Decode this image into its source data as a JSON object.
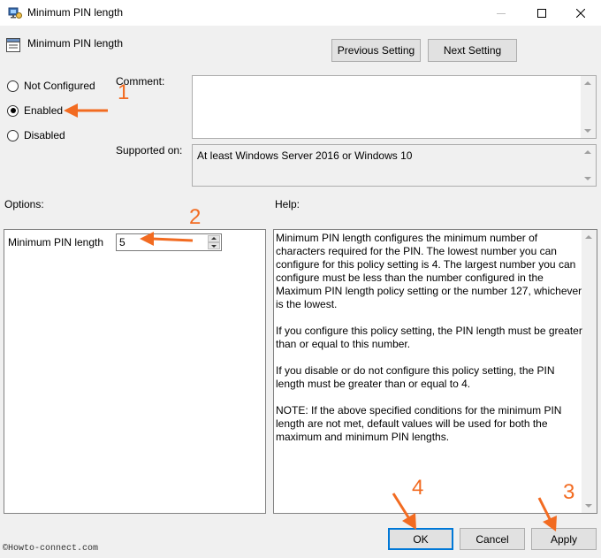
{
  "window": {
    "title": "Minimum PIN length"
  },
  "header": {
    "policy_title": "Minimum PIN length",
    "previous_label": "Previous Setting",
    "next_label": "Next Setting"
  },
  "state": {
    "options": [
      {
        "label": "Not Configured",
        "checked": false
      },
      {
        "label": "Enabled",
        "checked": true
      },
      {
        "label": "Disabled",
        "checked": false
      }
    ]
  },
  "comment": {
    "label": "Comment:",
    "value": ""
  },
  "supported": {
    "label": "Supported on:",
    "value": "At least Windows Server 2016 or Windows 10"
  },
  "options_panel": {
    "heading": "Options:",
    "field_label": "Minimum PIN length",
    "field_value": "5"
  },
  "help_panel": {
    "heading": "Help:",
    "paragraphs": [
      "Minimum PIN length configures the minimum number of characters required for the PIN.  The lowest number you can configure for this policy setting is 4.  The largest number you can configure must be less than the number configured in the Maximum PIN length policy setting or the number 127, whichever is the lowest.",
      "If you configure this policy setting, the PIN length must be greater than or equal to this number.",
      "If you disable or do not configure this policy setting, the PIN length must be greater than or equal to 4.",
      "NOTE: If the above specified conditions for the minimum PIN length are not met, default values will be used for both the maximum and minimum PIN lengths."
    ]
  },
  "footer": {
    "ok_label": "OK",
    "cancel_label": "Cancel",
    "apply_label": "Apply"
  },
  "annotations": {
    "n1": "1",
    "n2": "2",
    "n3": "3",
    "n4": "4",
    "color": "#f26b21"
  },
  "watermark": "©Howto-connect.com"
}
